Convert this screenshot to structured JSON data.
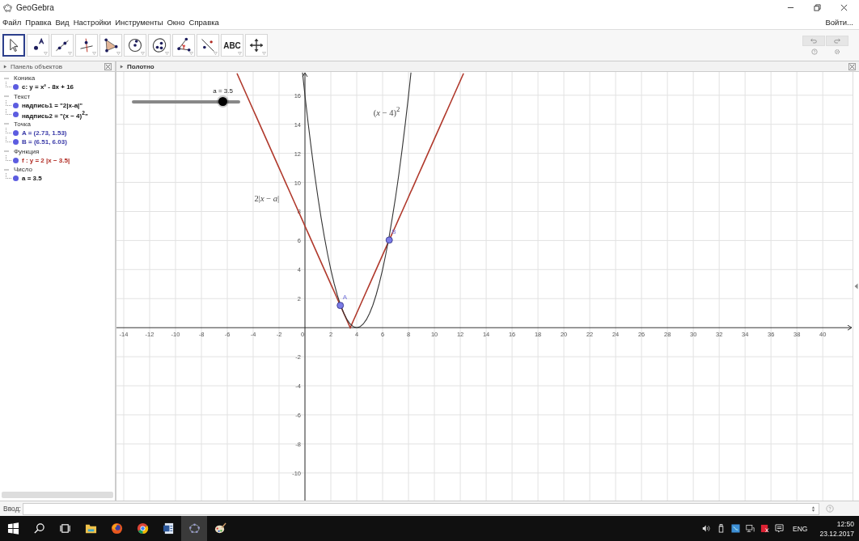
{
  "window": {
    "title": "GeoGebra"
  },
  "menu": [
    "Файл",
    "Правка",
    "Вид",
    "Настройки",
    "Инструменты",
    "Окно",
    "Справка"
  ],
  "login": "Войти...",
  "tools": [
    {
      "kind": "move",
      "selected": true
    },
    {
      "kind": "point",
      "selected": false
    },
    {
      "kind": "line",
      "selected": false
    },
    {
      "kind": "perpendicular",
      "selected": false
    },
    {
      "kind": "polygon",
      "selected": false
    },
    {
      "kind": "circle",
      "selected": false
    },
    {
      "kind": "conic",
      "selected": false
    },
    {
      "kind": "angle",
      "selected": false
    },
    {
      "kind": "reflect",
      "selected": false
    },
    {
      "kind": "text",
      "label": "ABC",
      "selected": false
    },
    {
      "kind": "pan",
      "selected": false
    }
  ],
  "algebra": {
    "title": "Панель объектов",
    "groups": [
      {
        "label": "Коника",
        "expanded": true,
        "items": [
          {
            "text": "c: y = x² - 8x + 16",
            "color": "#111111"
          }
        ]
      },
      {
        "label": "Текст",
        "expanded": true,
        "items": [
          {
            "text": "надпись1 = \"2|x-a|\"",
            "color": "#111111"
          },
          {
            "text": "надпись2 = \"(x − 4)$^{2}$\"",
            "color": "#111111"
          }
        ]
      },
      {
        "label": "Точка",
        "expanded": true,
        "items": [
          {
            "text": "A = (2.73, 1.53)",
            "color": "#3a3aa8"
          },
          {
            "text": "B = (6.51, 6.03)",
            "color": "#3a3aa8"
          }
        ]
      },
      {
        "label": "Функция",
        "expanded": true,
        "items": [
          {
            "text": "f : y = 2 |x − 3.5|",
            "color": "#b02a22"
          }
        ]
      },
      {
        "label": "Число",
        "expanded": true,
        "items": [
          {
            "text": "a = 3.5",
            "color": "#111111"
          }
        ]
      }
    ]
  },
  "graphics": {
    "title": "Полотно",
    "slider": {
      "label": "a = 3.5",
      "level": 0.84
    },
    "chart_data": {
      "type": "line",
      "xlim": [
        -14.56,
        42.3
      ],
      "ylim": [
        -11.9,
        17.6
      ],
      "xticks": [
        -14,
        -12,
        -10,
        -8,
        -6,
        -4,
        -2,
        0,
        2,
        4,
        6,
        8,
        10,
        12,
        14,
        16,
        18,
        20,
        22,
        24,
        26,
        28,
        30,
        32,
        34,
        36,
        38,
        40
      ],
      "yticks": [
        -10,
        -8,
        -6,
        -4,
        -2,
        2,
        4,
        6,
        8,
        10,
        12,
        14,
        16
      ],
      "grid": true,
      "x": [
        -5.25,
        -5,
        -4.75,
        -4.5,
        -4.25,
        -4,
        -3.75,
        -3.5,
        -3.25,
        -3,
        -2.75,
        -2.5,
        -2.25,
        -2,
        -1.75,
        -1.5,
        -1.25,
        -1,
        -0.75,
        -0.5,
        -0.25,
        -0.19,
        0,
        0.25,
        0.5,
        0.75,
        1,
        1.25,
        1.5,
        1.75,
        2,
        2.25,
        2.5,
        2.73,
        2.75,
        3,
        3.25,
        3.5,
        3.75,
        4,
        4.25,
        4.5,
        4.75,
        5,
        5.25,
        5.5,
        5.75,
        6,
        6.25,
        6.5,
        6.51,
        6.75,
        7,
        7.25,
        7.5,
        7.75,
        8,
        8.19,
        8.25,
        8.5,
        8.75,
        9,
        9.25,
        9.5,
        9.75,
        10,
        10.25,
        10.5,
        10.75,
        11,
        11.25,
        11.5,
        11.75,
        12,
        12.25
      ],
      "series": [
        {
          "color": "#b0392c",
          "values": [
            17.5,
            17,
            16.5,
            16,
            15.5,
            15,
            14.5,
            14,
            13.5,
            13,
            12.5,
            12,
            11.5,
            11,
            10.5,
            10,
            9.5,
            9,
            8.5,
            8,
            7.5,
            7.38,
            7,
            6.5,
            6,
            5.5,
            5,
            4.5,
            4,
            3.5,
            3,
            2.5,
            2,
            1.53,
            1.5,
            1,
            0.5,
            0,
            0.5,
            1,
            1.5,
            2,
            2.5,
            3,
            3.5,
            4,
            4.5,
            5,
            5.5,
            6,
            6.03,
            6.5,
            7,
            7.5,
            8,
            8.5,
            9,
            9.38,
            9.5,
            10,
            10.5,
            11,
            11.5,
            12,
            12.5,
            13,
            13.5,
            14,
            14.5,
            15,
            15.5,
            16,
            16.5,
            17,
            17.5
          ]
        },
        {
          "color": "#333333",
          "values": [
            null,
            null,
            null,
            null,
            null,
            null,
            null,
            null,
            null,
            null,
            null,
            null,
            null,
            null,
            null,
            null,
            null,
            null,
            null,
            null,
            null,
            17.56,
            16,
            14.06,
            12.25,
            10.56,
            9,
            7.56,
            6.25,
            5.06,
            4,
            3.06,
            2.25,
            1.61,
            1.56,
            1,
            0.56,
            0.25,
            0.06,
            0,
            0.06,
            0.25,
            0.56,
            1,
            1.56,
            2.25,
            3.06,
            4,
            5.06,
            6.25,
            6.3,
            7.56,
            9,
            10.56,
            12.25,
            14.06,
            16,
            17.56,
            null,
            null,
            null,
            null,
            null,
            null,
            null,
            null,
            null,
            null,
            null,
            null,
            null,
            null,
            null,
            null,
            null
          ]
        }
      ],
      "annotations": [
        {
          "text": "A",
          "x": 2.73,
          "y": 1.53
        },
        {
          "text": "B",
          "x": 6.51,
          "y": 6.03
        },
        "(*x* − 4)$^{2}$",
        "2|*x* − *a*|"
      ]
    }
  },
  "input": {
    "label": "Ввод:"
  },
  "taskbar": {
    "apps": [
      {
        "kind": "windows",
        "selected": false
      },
      {
        "kind": "search",
        "selected": false
      },
      {
        "kind": "taskview",
        "selected": false
      },
      {
        "kind": "folder",
        "selected": false
      },
      {
        "kind": "firefox",
        "selected": false
      },
      {
        "kind": "chrome",
        "selected": false
      },
      {
        "kind": "document",
        "selected": false
      },
      {
        "kind": "geogebra",
        "selected": true
      },
      {
        "kind": "paint",
        "selected": false
      }
    ],
    "language": "ENG",
    "time": "12:50",
    "date": "23.12.2017"
  }
}
